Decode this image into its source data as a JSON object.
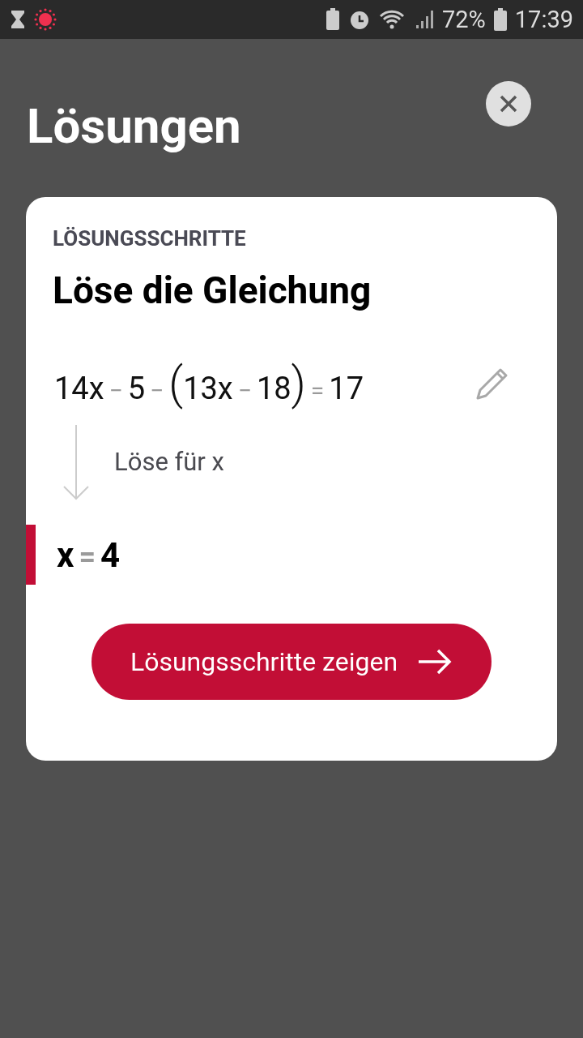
{
  "status_bar": {
    "battery_percent": "72%",
    "time": "17:39"
  },
  "title": "Lösungen",
  "card": {
    "section_label": "LÖSUNGSSCHRITTE",
    "heading": "Löse die Gleichung",
    "equation": [
      {
        "kind": "term",
        "text": "14x"
      },
      {
        "kind": "op",
        "text": "−"
      },
      {
        "kind": "term",
        "text": "5"
      },
      {
        "kind": "op",
        "text": "−"
      },
      {
        "kind": "paren",
        "text": "("
      },
      {
        "kind": "term",
        "text": "13x"
      },
      {
        "kind": "op",
        "text": "−"
      },
      {
        "kind": "term",
        "text": "18"
      },
      {
        "kind": "paren",
        "text": ")"
      },
      {
        "kind": "op",
        "text": "="
      },
      {
        "kind": "term",
        "text": "17"
      }
    ],
    "step_label": "Löse für x",
    "result": [
      {
        "kind": "term",
        "text": "x"
      },
      {
        "kind": "op",
        "text": "="
      },
      {
        "kind": "term",
        "text": "4"
      }
    ],
    "button": "Lösungsschritte zeigen"
  }
}
